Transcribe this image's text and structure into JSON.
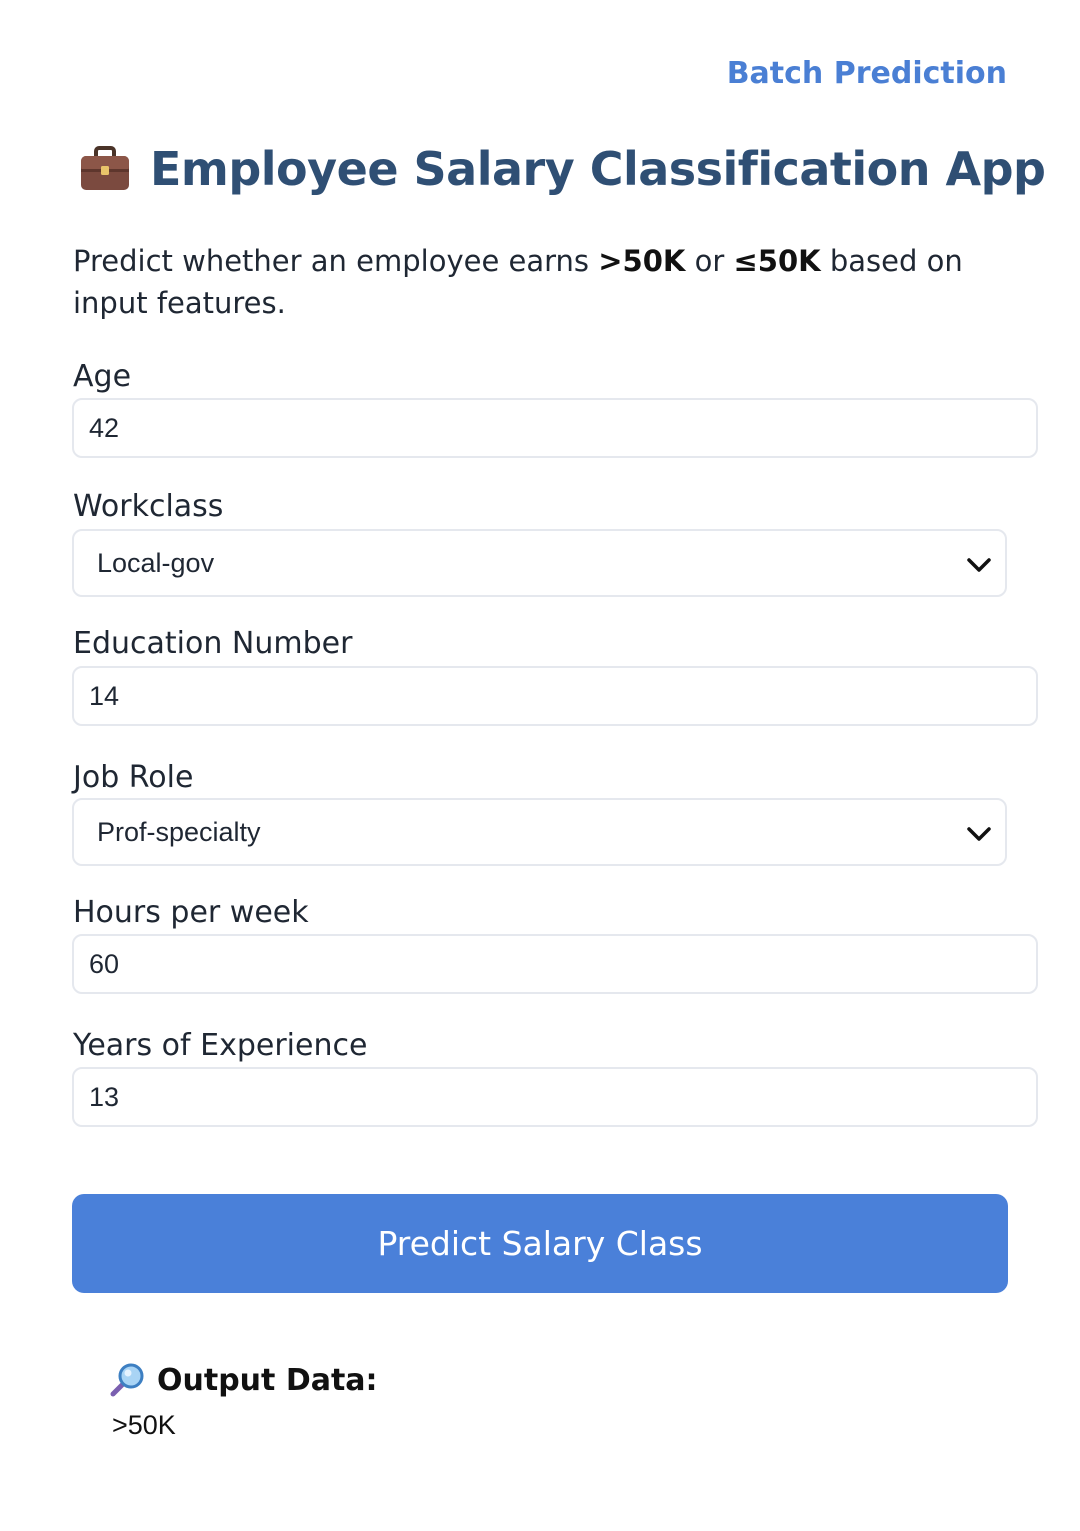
{
  "nav": {
    "batch_link": "Batch Prediction"
  },
  "header": {
    "icon": "briefcase-icon",
    "title": "Employee Salary Classification App",
    "subtitle_prefix": "Predict whether an employee earns ",
    "subtitle_bold1": ">50K",
    "subtitle_mid": " or ",
    "subtitle_bold2": "≤50K",
    "subtitle_suffix": " based on input features."
  },
  "form": {
    "age": {
      "label": "Age",
      "value": "42"
    },
    "workclass": {
      "label": "Workclass",
      "value": "Local-gov"
    },
    "education": {
      "label": "Education Number",
      "value": "14"
    },
    "job_role": {
      "label": "Job Role",
      "value": "Prof-specialty"
    },
    "hours": {
      "label": "Hours per week",
      "value": "60"
    },
    "experience": {
      "label": "Years of Experience",
      "value": "13"
    },
    "submit_label": "Predict Salary Class"
  },
  "output": {
    "icon": "magnifier-icon",
    "heading": "Output Data:",
    "value": ">50K"
  },
  "colors": {
    "accent": "#4a80d9",
    "title": "#2f4f74",
    "link": "#4a7fd4"
  }
}
